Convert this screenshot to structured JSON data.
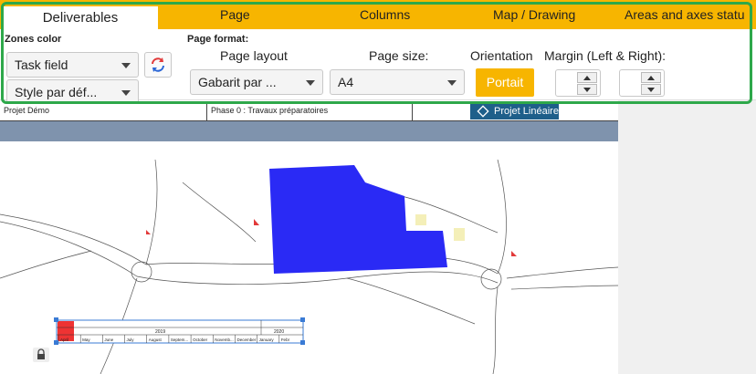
{
  "ribbon": {
    "tabs": [
      {
        "label": "Deliverables",
        "active": true
      },
      {
        "label": "Page"
      },
      {
        "label": "Columns"
      },
      {
        "label": "Map / Drawing"
      },
      {
        "label": "Areas and axes statu"
      }
    ],
    "zones_color": {
      "label": "Zones color",
      "field_value": "Task field",
      "style_value": "Style par déf..."
    },
    "page_format": {
      "label": "Page format:",
      "layout_label": "Page layout",
      "layout_value": "Gabarit par ...",
      "size_label": "Page size:",
      "size_value": "A4",
      "orientation_label": "Orientation",
      "orientation_value": "Portait",
      "margin_label": "Margin (Left & Right):"
    }
  },
  "document": {
    "project_name": "Projet Démo",
    "phase": "Phase 0 : Travaux préparatoires",
    "badge": "Projet Linéaire",
    "timeline_year_1": "2019",
    "timeline_year_2": "2020",
    "timeline_months": [
      "April",
      "May",
      "June",
      "July",
      "August",
      "Septem...",
      "October",
      "Novemb...",
      "December",
      "January",
      "Febr"
    ]
  },
  "colors": {
    "accent": "#f7b500",
    "highlight": "#2ea84a",
    "building": "#2a2af5",
    "band": "#7f93ad",
    "badge": "#1e5f8a"
  }
}
